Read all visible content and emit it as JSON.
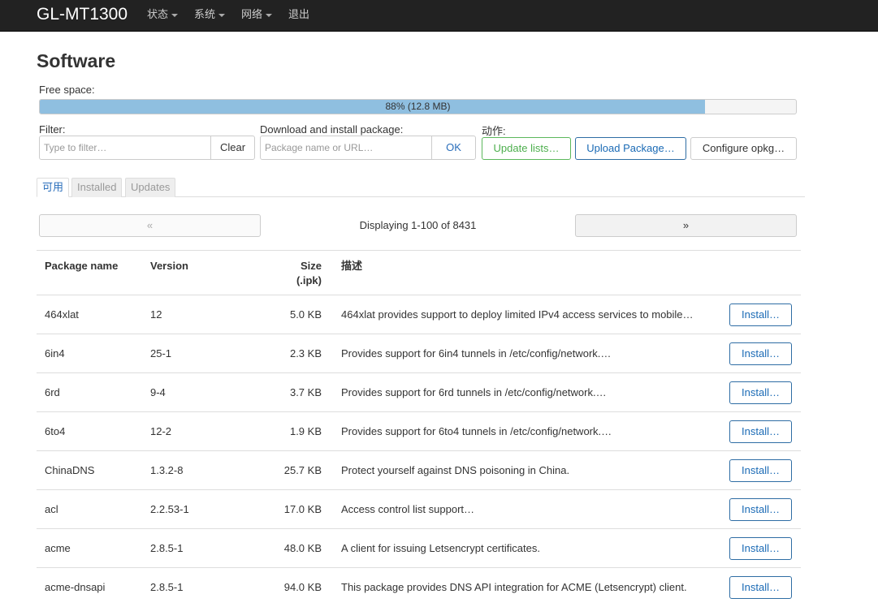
{
  "navbar": {
    "brand": "GL-MT1300",
    "menu": [
      "状态",
      "系统",
      "网络",
      "退出"
    ]
  },
  "page": {
    "title": "Software",
    "free_space_label": "Free space:",
    "free_space_percent": 88,
    "free_space_text": "88% (12.8 MB)",
    "filter_label": "Filter:",
    "filter_placeholder": "Type to filter…",
    "clear_label": "Clear",
    "download_label": "Download and install package:",
    "download_placeholder": "Package name or URL…",
    "ok_label": "OK",
    "actions_label": "动作:",
    "update_lists_label": "Update lists…",
    "upload_package_label": "Upload Package…",
    "configure_opkg_label": "Configure opkg…"
  },
  "tabs": [
    "可用",
    "Installed",
    "Updates"
  ],
  "pager": {
    "prev": "«",
    "next": "»",
    "text": "Displaying 1-100 of 8431"
  },
  "table": {
    "headers": [
      "Package name",
      "Version",
      "Size",
      "(.ipk)",
      "描述"
    ],
    "install_label": "Install…",
    "rows": [
      {
        "name": "464xlat",
        "version": "12",
        "size": "5.0 KB",
        "desc": "464xlat provides support to deploy limited IPv4 access services to mobile…"
      },
      {
        "name": "6in4",
        "version": "25-1",
        "size": "2.3 KB",
        "desc": "Provides support for 6in4 tunnels in /etc/config/network.…"
      },
      {
        "name": "6rd",
        "version": "9-4",
        "size": "3.7 KB",
        "desc": "Provides support for 6rd tunnels in /etc/config/network.…"
      },
      {
        "name": "6to4",
        "version": "12-2",
        "size": "1.9 KB",
        "desc": "Provides support for 6to4 tunnels in /etc/config/network.…"
      },
      {
        "name": "ChinaDNS",
        "version": "1.3.2-8",
        "size": "25.7 KB",
        "desc": "Protect yourself against DNS poisoning in China."
      },
      {
        "name": "acl",
        "version": "2.2.53-1",
        "size": "17.0 KB",
        "desc": "Access control list support…"
      },
      {
        "name": "acme",
        "version": "2.8.5-1",
        "size": "48.0 KB",
        "desc": "A client for issuing Letsencrypt certificates."
      },
      {
        "name": "acme-dnsapi",
        "version": "2.8.5-1",
        "size": "94.0 KB",
        "desc": "This package provides DNS API integration for ACME (Letsencrypt) client."
      }
    ]
  }
}
